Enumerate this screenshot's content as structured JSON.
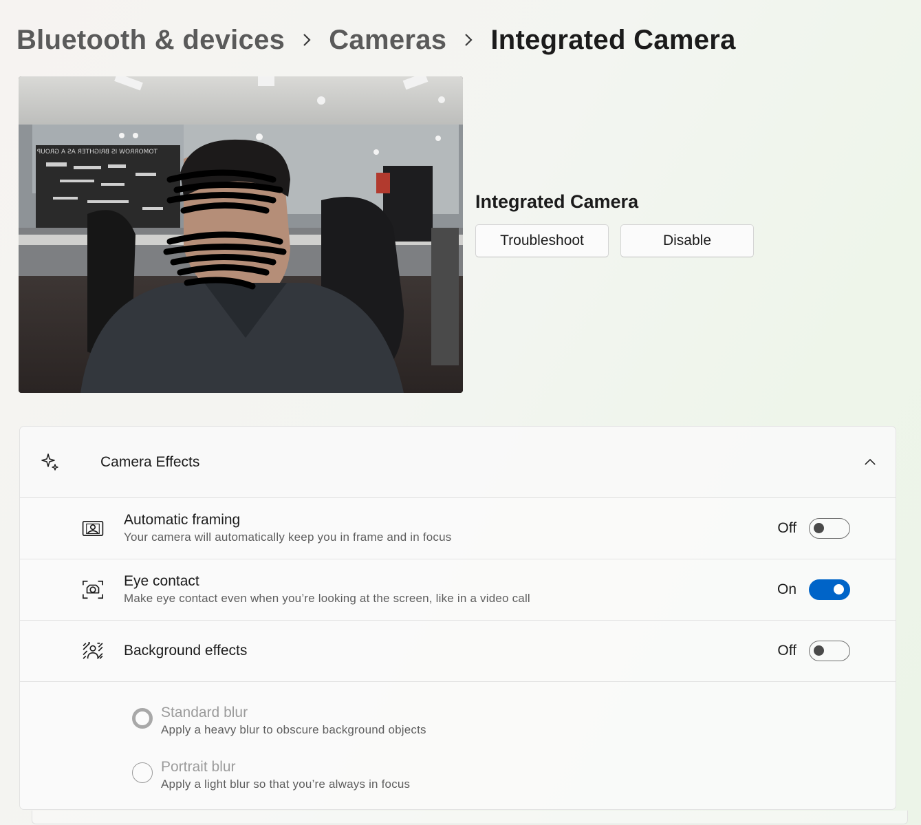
{
  "breadcrumb": {
    "items": [
      "Bluetooth & devices",
      "Cameras"
    ],
    "current": "Integrated Camera"
  },
  "preview": {
    "poster_text": "TOMORROW IS BRIGHTER AS A GROUP"
  },
  "camera": {
    "name": "Integrated Camera",
    "troubleshoot_label": "Troubleshoot",
    "disable_label": "Disable"
  },
  "effects": {
    "title": "Camera Effects",
    "icon": "sparkle-icon",
    "automatic_framing": {
      "title": "Automatic framing",
      "subtitle": "Your camera will automatically keep you in frame and in focus",
      "state_label": "Off",
      "on": false,
      "icon": "framing-icon"
    },
    "eye_contact": {
      "title": "Eye contact",
      "subtitle": "Make eye contact even when you’re looking at the screen, like in a video call",
      "state_label": "On",
      "on": true,
      "icon": "eye-contact-icon"
    },
    "background_effects": {
      "title": "Background effects",
      "state_label": "Off",
      "on": false,
      "icon": "background-icon",
      "options": [
        {
          "title": "Standard blur",
          "subtitle": "Apply a heavy blur to obscure background objects",
          "selected": true
        },
        {
          "title": "Portrait blur",
          "subtitle": "Apply a light blur so that you’re always in focus",
          "selected": false
        }
      ]
    }
  },
  "colors": {
    "accent": "#0064c8",
    "disabled_text": "#9b9b9b"
  }
}
